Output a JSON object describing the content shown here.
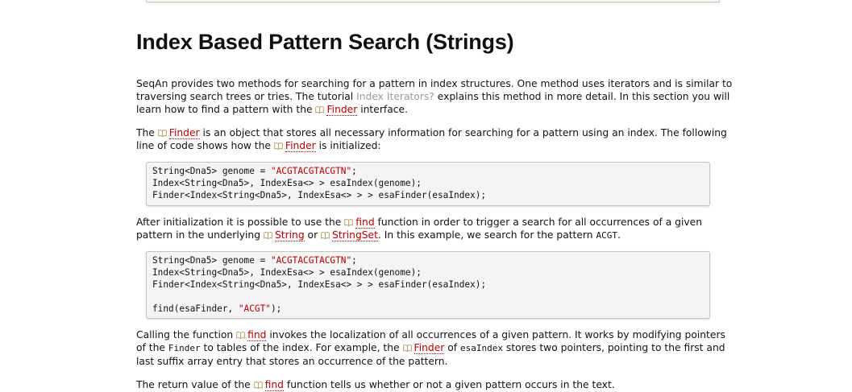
{
  "heading": "Index Based Pattern Search (Strings)",
  "p1": {
    "t1": "SeqAn provides two methods for searching for a pattern in index structures. One method uses iterators and is similar to traversing search trees or tries. The tutorial ",
    "link": "Index Iterators?",
    "t2": " explains this method in more detail. In this section you will learn how to find a pattern with the ",
    "ref": "Finder",
    "t3": " interface."
  },
  "p2": {
    "t1": "The ",
    "ref1": "Finder",
    "t2": " is an object that stores all necessary information for searching for a pattern using an index. The following line of code shows how the ",
    "ref2": "Finder",
    "t3": " is initialized:"
  },
  "code1": [
    {
      "pre": "String<Dna5> genome = ",
      "str": "\"ACGTACGTACGTN\"",
      "post": ";"
    },
    {
      "pre": "Index<String<Dna5>, IndexEsa<> > esaIndex(genome);",
      "str": "",
      "post": ""
    },
    {
      "pre": "Finder<Index<String<Dna5>, IndexEsa<> > > esaFinder(esaIndex);",
      "str": "",
      "post": ""
    }
  ],
  "p3": {
    "t1": "After initialization it is possible to use the ",
    "ref1": "find",
    "t2": " function in order to trigger a search for all occurrences of a given pattern in the underlying ",
    "ref2": "String",
    "t3": " or ",
    "ref3": "StringSet",
    "t4": ". In this example, we search for the pattern ",
    "code": "ACGT",
    "t5": "."
  },
  "code2": [
    {
      "pre": "String<Dna5> genome = ",
      "str": "\"ACGTACGTACGTN\"",
      "post": ";"
    },
    {
      "pre": "Index<String<Dna5>, IndexEsa<> > esaIndex(genome);",
      "str": "",
      "post": ""
    },
    {
      "pre": "Finder<Index<String<Dna5>, IndexEsa<> > > esaFinder(esaIndex);",
      "str": "",
      "post": ""
    },
    {
      "pre": "",
      "str": "",
      "post": ""
    },
    {
      "pre": "find(esaFinder, ",
      "str": "\"ACGT\"",
      "post": ");"
    }
  ],
  "p4": {
    "t1": "Calling the function ",
    "ref1": "find",
    "t2": " invokes the localization of all occurrences of a given pattern. It works by modifying pointers of the ",
    "code1": "Finder",
    "t3": " to tables of the index. For example, the ",
    "ref2": "Finder",
    "t4": " of ",
    "code2": "esaIndex",
    "t5": " stores two pointers, pointing to the first and last suffix array entry that stores an occurrence of the pattern."
  },
  "p5": {
    "t1": "The return value of the ",
    "ref1": "find",
    "t2": " function tells us whether or not a given pattern occurs in the text."
  },
  "icons": {
    "book": "book-icon"
  }
}
